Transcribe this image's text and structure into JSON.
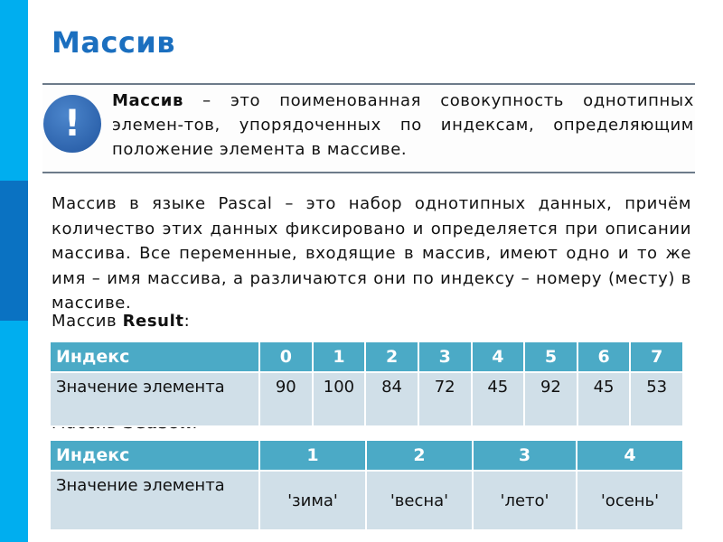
{
  "slide": {
    "title": "Массив",
    "definition": {
      "term": "Массив",
      "rest": " – это поименованная совокупность однотипных элемен-тов, упорядоченных по индексам, определяющим положение элемента в массиве."
    },
    "paragraph": "Массив в языке Pascal – это набор однотипных данных, причём количество этих данных фиксировано и определяется при описании массива. Все переменные, входящие в массив, имеют одно и то же имя – имя массива, а различаются они по индексу – номеру (месту) в массиве.",
    "caption_result": {
      "prefix": "Массив ",
      "name": "Result",
      "suffix": ":"
    },
    "caption_season": {
      "prefix": "Массив ",
      "name": "Season",
      "suffix": ":"
    },
    "icon": "exclamation-icon"
  },
  "tables": {
    "result": {
      "index_label": "Индекс",
      "value_label": "Значение элемента",
      "indices": [
        "0",
        "1",
        "2",
        "3",
        "4",
        "5",
        "6",
        "7"
      ],
      "values": [
        "90",
        "100",
        "84",
        "72",
        "45",
        "92",
        "45",
        "53"
      ]
    },
    "season": {
      "index_label": "Индекс",
      "value_label": "Значение элемента",
      "indices": [
        "1",
        "2",
        "3",
        "4"
      ],
      "values": [
        "'зима'",
        "'весна'",
        "'лето'",
        "'осень'"
      ]
    }
  },
  "colors": {
    "side_bar": "#00aeef",
    "side_bar_dark": "#0a72c2",
    "title": "#1b6fbf",
    "table_header": "#4baac6",
    "table_body": "#d0dfe8"
  }
}
